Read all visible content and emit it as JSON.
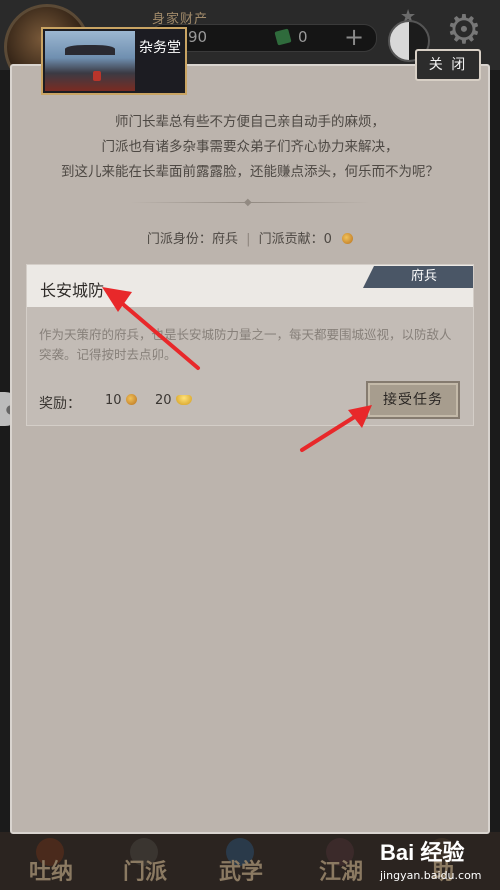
{
  "top_bar": {
    "wealth_label": "身家财产",
    "wealth_value": "90",
    "jade_value": "0",
    "plus": "+"
  },
  "dialog": {
    "badge_title": "杂务堂",
    "close_label": "关 闭",
    "intro_lines": [
      "师门长辈总有些不方便自己亲自动手的麻烦，",
      "门派也有诸多杂事需要众弟子们齐心协力来解决，",
      "到这儿来能在长辈面前露露脸，还能赚点添头，何乐而不为呢？"
    ],
    "status": {
      "identity_label": "门派身份：",
      "identity_value": "府兵",
      "separator": "|",
      "contribution_label": "门派贡献：",
      "contribution_value": "0"
    }
  },
  "task": {
    "title": "长安城防",
    "rank": "府兵",
    "description": "作为天策府的府兵，也是长安城防力量之一，每天都要围城巡视，以防敌人突袭。记得按时去点卯。",
    "reward_label": "奖励：",
    "reward_contribution": "10",
    "reward_silver": "20",
    "accept_label": "接受任务"
  },
  "bottom_nav": [
    {
      "label": "吐纳"
    },
    {
      "label": "门派"
    },
    {
      "label": "武学"
    },
    {
      "label": "江湖"
    },
    {
      "label": "助"
    }
  ],
  "watermark": {
    "brand": "Bai 经验",
    "url": "jingyan.baidu.com"
  },
  "colors": {
    "panel_bg": "#bcb4ad",
    "rank_tag": "#4a5666",
    "badge_border": "#c9a463",
    "annotation_arrow": "#e8282a"
  }
}
